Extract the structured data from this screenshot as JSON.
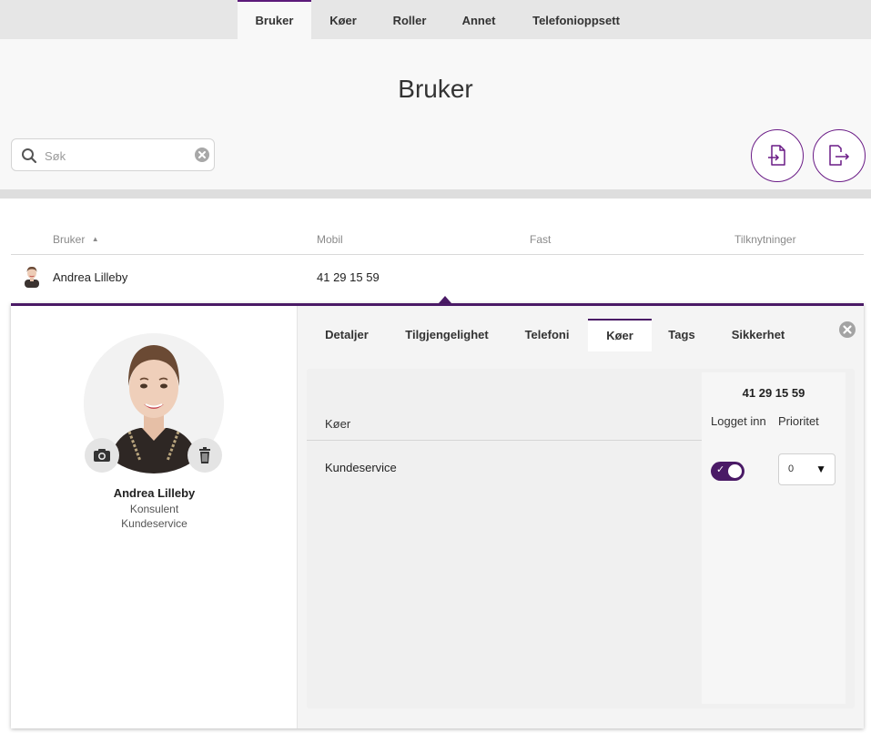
{
  "nav": {
    "tabs": [
      {
        "label": "Bruker",
        "active": true
      },
      {
        "label": "Køer",
        "active": false
      },
      {
        "label": "Roller",
        "active": false
      },
      {
        "label": "Annet",
        "active": false
      },
      {
        "label": "Telefonioppsett",
        "active": false
      }
    ]
  },
  "page": {
    "title": "Bruker"
  },
  "search": {
    "placeholder": "Søk",
    "value": ""
  },
  "actions": {
    "import_icon": "file-import-icon",
    "export_icon": "file-export-icon"
  },
  "table": {
    "headers": {
      "user": "Bruker",
      "sort_indicator": "▲",
      "mobile": "Mobil",
      "landline": "Fast",
      "links": "Tilknytninger"
    },
    "rows": [
      {
        "name": "Andrea Lilleby",
        "mobile": "41 29 15 59",
        "landline": "",
        "links": ""
      }
    ]
  },
  "detail": {
    "profile": {
      "name": "Andrea Lilleby",
      "role": "Konsulent",
      "department": "Kundeservice"
    },
    "tabs": [
      {
        "label": "Detaljer",
        "active": false
      },
      {
        "label": "Tilgjengelighet",
        "active": false
      },
      {
        "label": "Telefoni",
        "active": false
      },
      {
        "label": "Køer",
        "active": true
      },
      {
        "label": "Tags",
        "active": false
      },
      {
        "label": "Sikkerhet",
        "active": false
      }
    ],
    "queues": {
      "column_label": "Køer",
      "number": "41 29 15 59",
      "logged_in_label": "Logget inn",
      "priority_label": "Prioritet",
      "items": [
        {
          "name": "Kundeservice",
          "logged_in": true,
          "priority": "0"
        }
      ]
    }
  },
  "colors": {
    "accent": "#4a1a66",
    "accent_border": "#6a1b86"
  }
}
